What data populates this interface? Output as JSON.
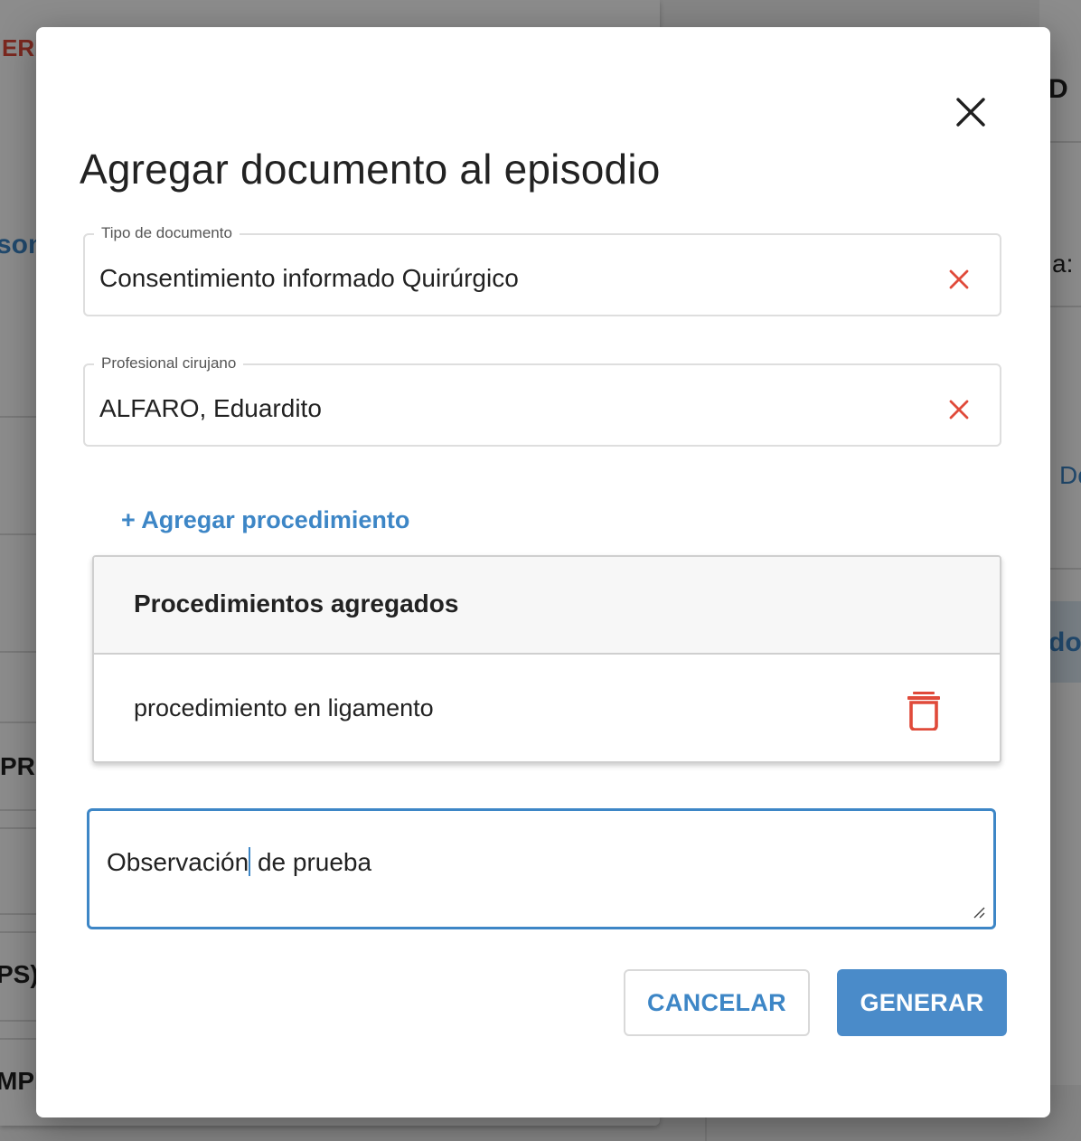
{
  "modal": {
    "title": "Agregar documento al episodio",
    "close_icon": "close-icon"
  },
  "document_type": {
    "label": "Tipo de documento",
    "value": "Consentimiento informado Quirúrgico",
    "clear_icon": "clear-icon"
  },
  "surgeon": {
    "label": "Profesional cirujano",
    "value": "ALFARO, Eduardito",
    "clear_icon": "clear-icon"
  },
  "add_procedure_label": "+ Agregar procedimiento",
  "procedures": {
    "header": "Procedimientos agregados",
    "items": [
      {
        "name": "procedimiento en ligamento",
        "delete_icon": "trash-icon"
      }
    ]
  },
  "observation": {
    "value_before_caret": "Observación",
    "value_after_caret": " de prueba"
  },
  "actions": {
    "cancel_label": "CANCELAR",
    "generate_label": "GENERAR"
  },
  "background": {
    "fragments": [
      "ERI",
      "D",
      "son",
      "a: S",
      "Do",
      "dos",
      "PRO",
      "PS)",
      "MPR"
    ]
  },
  "colors": {
    "accent": "#3d86c6",
    "primary_button": "#4a8bc9",
    "danger": "#e04a3a",
    "overlay": "rgba(0,0,0,0.45)"
  }
}
